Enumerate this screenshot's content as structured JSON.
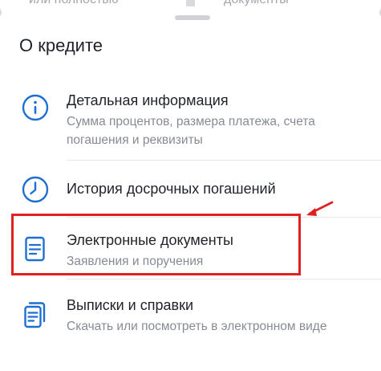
{
  "background": {
    "left_card_text": "или полностью",
    "right_card_text": "документы"
  },
  "sheet": {
    "title": "О кредите",
    "items": [
      {
        "icon": "info-icon",
        "label": "Детальная информация",
        "subtitle": "Сумма процентов, размера платежа, счета погашения и реквизиты"
      },
      {
        "icon": "clock-icon",
        "label": "История досрочных погашений"
      },
      {
        "icon": "document-icon",
        "label": "Электронные документы",
        "subtitle": "Заявления и поручения"
      },
      {
        "icon": "documents-stack-icon",
        "label": "Выписки и справки",
        "subtitle": "Скачать или посмотреть в электронном виде"
      }
    ]
  },
  "colors": {
    "icon_blue": "#1e6fd1",
    "highlight_red": "#e02121",
    "title_text": "#1f2229",
    "subtitle_text": "#878b93"
  }
}
